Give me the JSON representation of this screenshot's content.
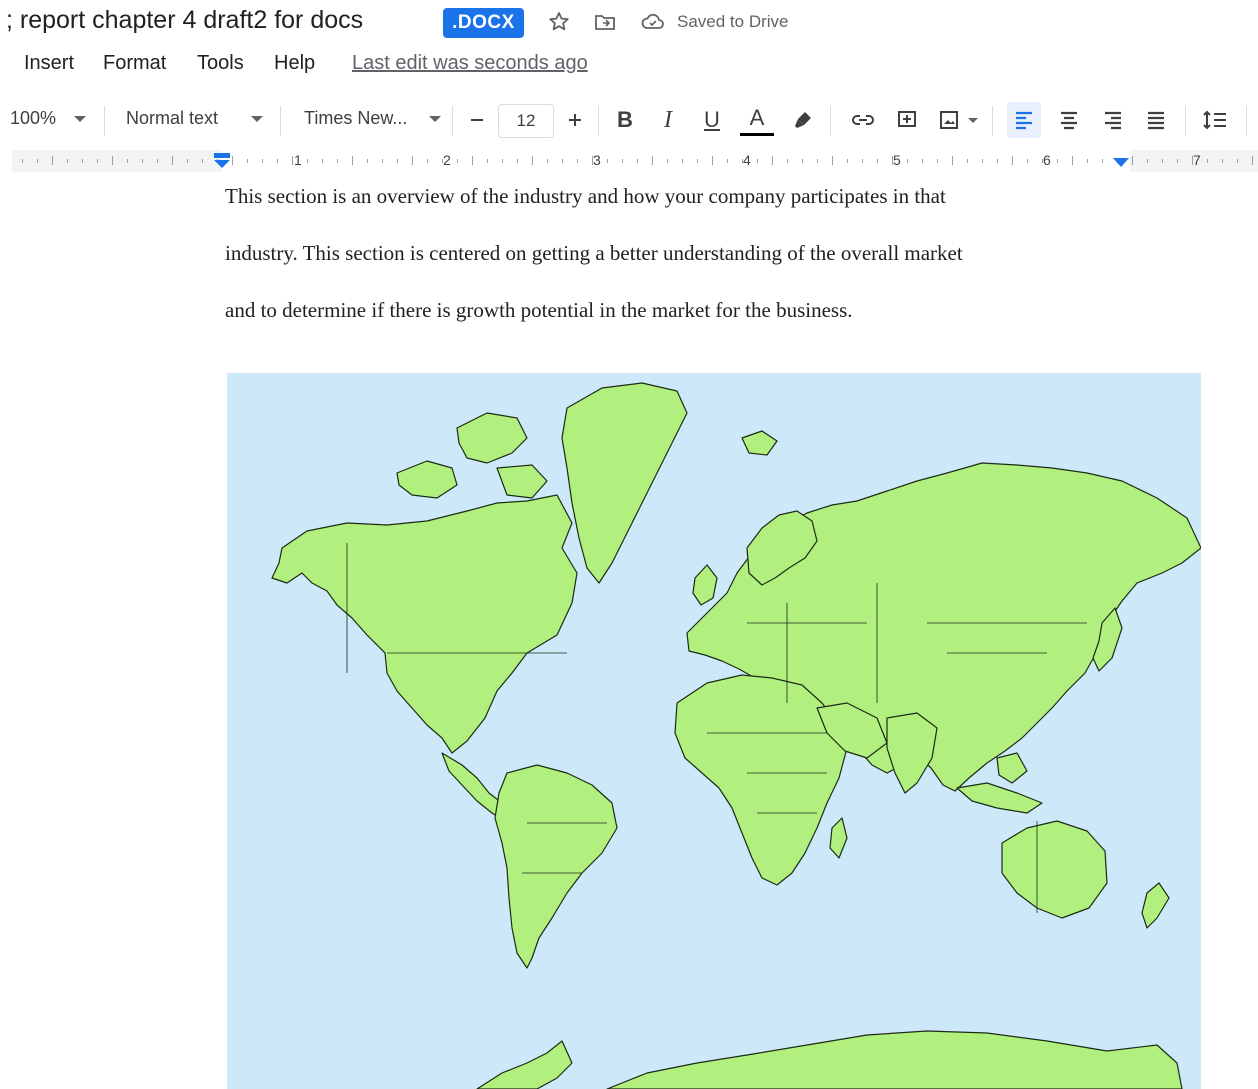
{
  "title_bar": {
    "doc_title": "; report chapter 4 draft2 for docs",
    "badge": ".DOCX",
    "saved_status": "Saved to Drive"
  },
  "menu": {
    "items": [
      "Insert",
      "Format",
      "Tools",
      "Help"
    ],
    "last_edit": "Last edit was seconds ago"
  },
  "toolbar": {
    "zoom": "100%",
    "style": "Normal text",
    "font": "Times New...",
    "font_size": "12",
    "bold": "B",
    "italic": "I",
    "underline": "U",
    "text_color": "A"
  },
  "ruler": {
    "numbers": [
      "1",
      "2",
      "3",
      "4",
      "5",
      "6",
      "7"
    ]
  },
  "document": {
    "paragraph_lines": [
      "This section is an overview of the industry and how your company participates in that",
      "industry.  This section is centered on getting a better understanding of the overall market",
      "and to determine if there is growth potential in the market for the business."
    ]
  },
  "colors": {
    "accent": "#1a73e8",
    "map_ocean": "#cde8f8",
    "map_land": "#b1f07f"
  }
}
